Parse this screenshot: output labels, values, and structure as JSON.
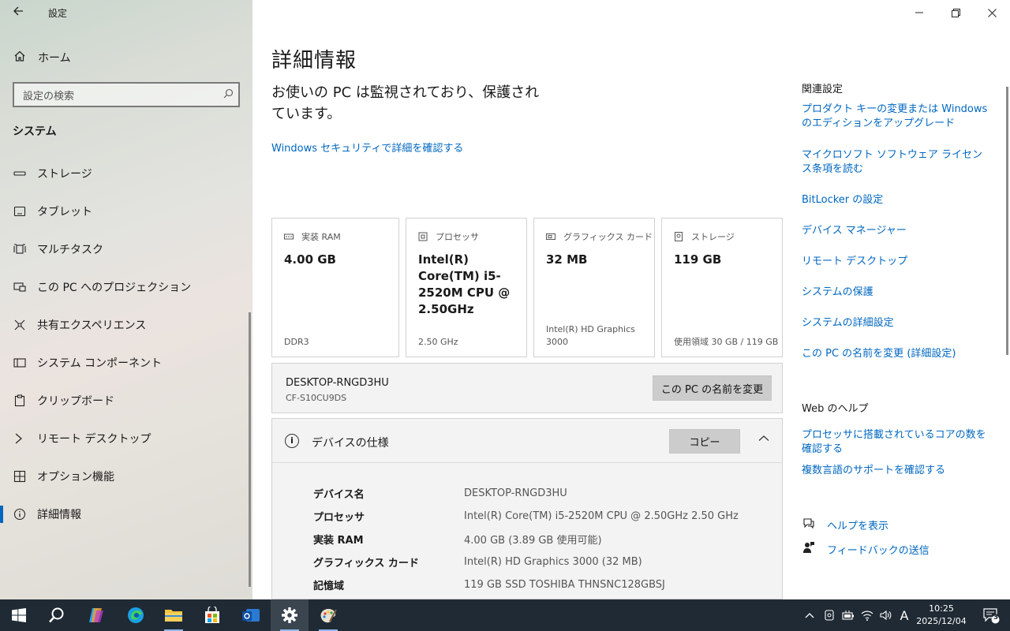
{
  "sidebar": {
    "title": "設定",
    "home_label": "ホーム",
    "search_placeholder": "設定の検索",
    "section_header": "システム",
    "items": [
      {
        "label": "ストレージ",
        "icon": "storage-icon"
      },
      {
        "label": "タブレット",
        "icon": "tablet-icon"
      },
      {
        "label": "マルチタスク",
        "icon": "multitask-icon"
      },
      {
        "label": "この PC へのプロジェクション",
        "icon": "projection-icon"
      },
      {
        "label": "共有エクスペリエンス",
        "icon": "share-icon"
      },
      {
        "label": "システム コンポーネント",
        "icon": "component-icon"
      },
      {
        "label": "クリップボード",
        "icon": "clipboard-icon"
      },
      {
        "label": "リモート デスクトップ",
        "icon": "remote-desktop-icon"
      },
      {
        "label": "オプション機能",
        "icon": "optional-features-icon"
      },
      {
        "label": "詳細情報",
        "icon": "info-icon",
        "active": true
      }
    ]
  },
  "main": {
    "title": "詳細情報",
    "protection_text": "お使いの PC は監視されており、保護されています。",
    "security_link": "Windows セキュリティで詳細を確認する",
    "cards": [
      {
        "label": "実装 RAM",
        "value": "4.00 GB",
        "sub": "DDR3",
        "icon": "ram-icon"
      },
      {
        "label": "プロセッサ",
        "value": "Intel(R) Core(TM) i5-2520M CPU @ 2.50GHz",
        "sub": "2.50 GHz",
        "icon": "cpu-icon"
      },
      {
        "label": "グラフィックス カード",
        "value": "32 MB",
        "sub": "Intel(R) HD Graphics 3000",
        "icon": "gpu-icon"
      },
      {
        "label": "ストレージ",
        "value": "119 GB",
        "sub": "使用領域 30 GB / 119 GB",
        "icon": "disk-icon"
      }
    ],
    "pc_name": "DESKTOP-RNGD3HU",
    "pc_model": "CF-S10CU9DS",
    "rename_button": "この PC の名前を変更",
    "spec_title": "デバイスの仕様",
    "copy_button": "コピー",
    "spec_rows": [
      {
        "key": "デバイス名",
        "value": "DESKTOP-RNGD3HU"
      },
      {
        "key": "プロセッサ",
        "value": "Intel(R) Core(TM) i5-2520M CPU @ 2.50GHz   2.50 GHz"
      },
      {
        "key": "実装 RAM",
        "value": "4.00 GB (3.89 GB 使用可能)"
      },
      {
        "key": "グラフィックス カード",
        "value": "Intel(R) HD Graphics 3000 (32 MB)"
      },
      {
        "key": "記憶域",
        "value": "119 GB SSD TOSHIBA THNSNC128GBSJ"
      }
    ]
  },
  "related": {
    "header": "関連設定",
    "links": [
      "プロダクト キーの変更または Windows のエディションをアップグレード",
      "マイクロソフト ソフトウェア ライセンス条項を読む",
      "BitLocker の設定",
      "デバイス マネージャー",
      "リモート デスクトップ",
      "システムの保護",
      "システムの詳細設定",
      "この PC の名前を変更 (詳細設定)"
    ],
    "web_help_header": "Web のヘルプ",
    "web_help_links": [
      "プロセッサに搭載されているコアの数を確認する",
      "複数言語のサポートを確認する"
    ],
    "help_label": "ヘルプを表示",
    "feedback_label": "フィードバックの送信"
  },
  "taskbar": {
    "ime": "A",
    "time": "10:25",
    "date": "2025/12/04",
    "notification_count": "3"
  },
  "colors": {
    "accent": "#0067c0",
    "taskbar": "#1f2a34"
  }
}
